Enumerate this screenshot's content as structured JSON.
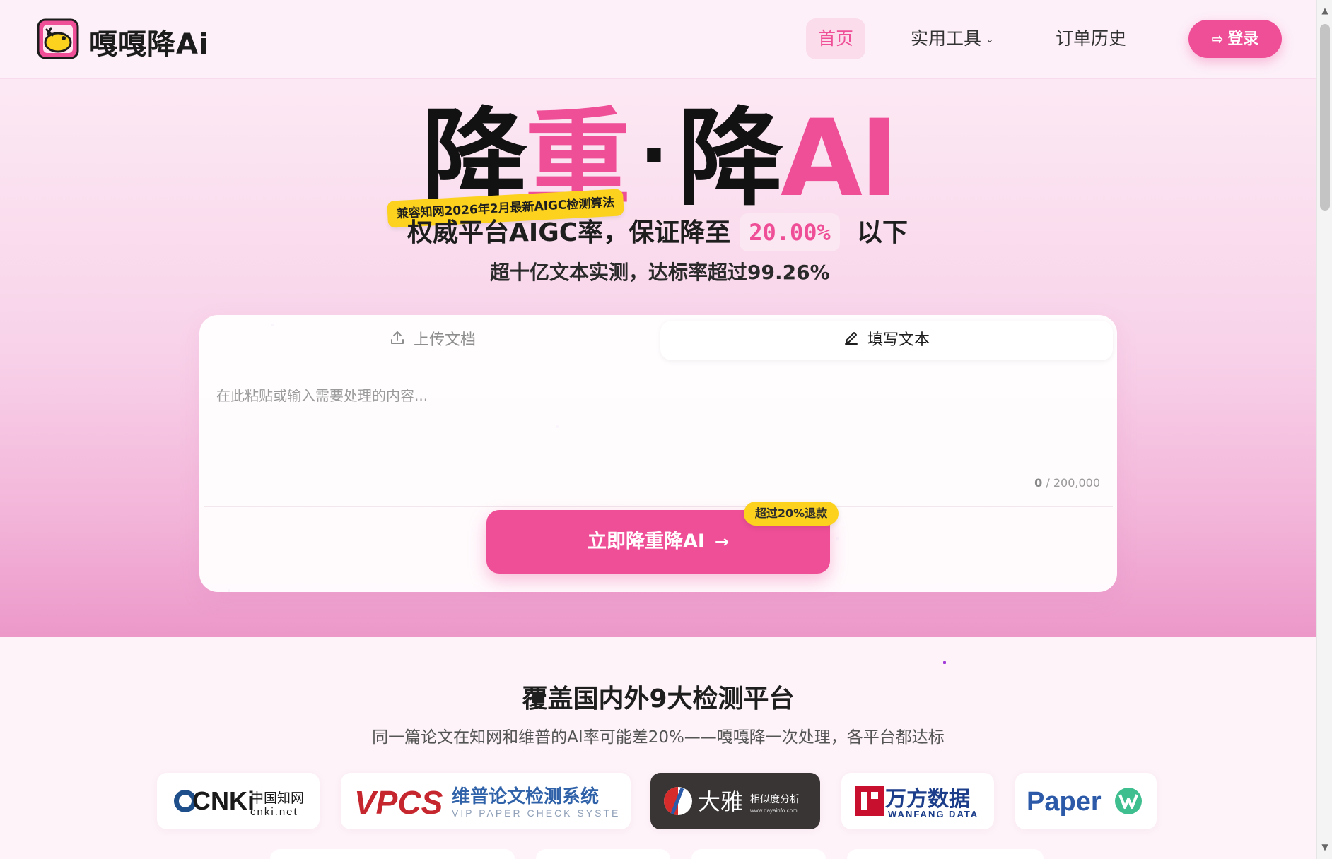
{
  "header": {
    "brand": "嘎嘎降Ai",
    "nav": {
      "home": "首页",
      "tools": "实用工具",
      "orders": "订单历史"
    },
    "login_label": "登录"
  },
  "hero": {
    "headline": {
      "part1": "降",
      "part2": "重",
      "dot": "·",
      "part3": "降",
      "part4": "AI"
    },
    "ribbon": "兼容知网2026年2月最新AIGC检测算法",
    "subtitle_prefix": "权威平台AIGC率，保证降至",
    "rate": "20.00%",
    "subtitle_suffix": "以下",
    "subtitle2": "超十亿文本实测，达标率超过99.26%"
  },
  "card": {
    "tabs": {
      "upload": "上传文档",
      "text": "填写文本"
    },
    "textarea_placeholder": "在此粘贴或输入需要处理的内容...",
    "counter_current": "0",
    "counter_sep": "/",
    "counter_max": "200,000",
    "cta_label": "立即降重降AI",
    "refund_badge": "超过20%退款"
  },
  "platforms_section": {
    "title": "覆盖国内外9大检测平台",
    "subtitle": "同一篇论文在知网和维普的AI率可能差20%——嘎嘎降一次处理，各平台都达标",
    "logos": {
      "cnki_main": "CNKi",
      "cnki_cn": "中国知网",
      "cnki_url": "cnki.net",
      "vpcs_main": "VPCS",
      "vpcs_cn": "维普论文检测系统",
      "vpcs_en": "VIP PAPER CHECK SYSTEM",
      "daya_main": "大雅",
      "daya_sub": "相似度分析",
      "daya_url": "www.dayainfo.com",
      "wanfang_cn": "万方数据",
      "wanfang_en": "WANFANG DATA",
      "paper_main": "Paper"
    }
  },
  "colors": {
    "accent": "#ef4f97",
    "badge_yellow": "#fcd21e",
    "text_dark": "#1e1e1e"
  }
}
